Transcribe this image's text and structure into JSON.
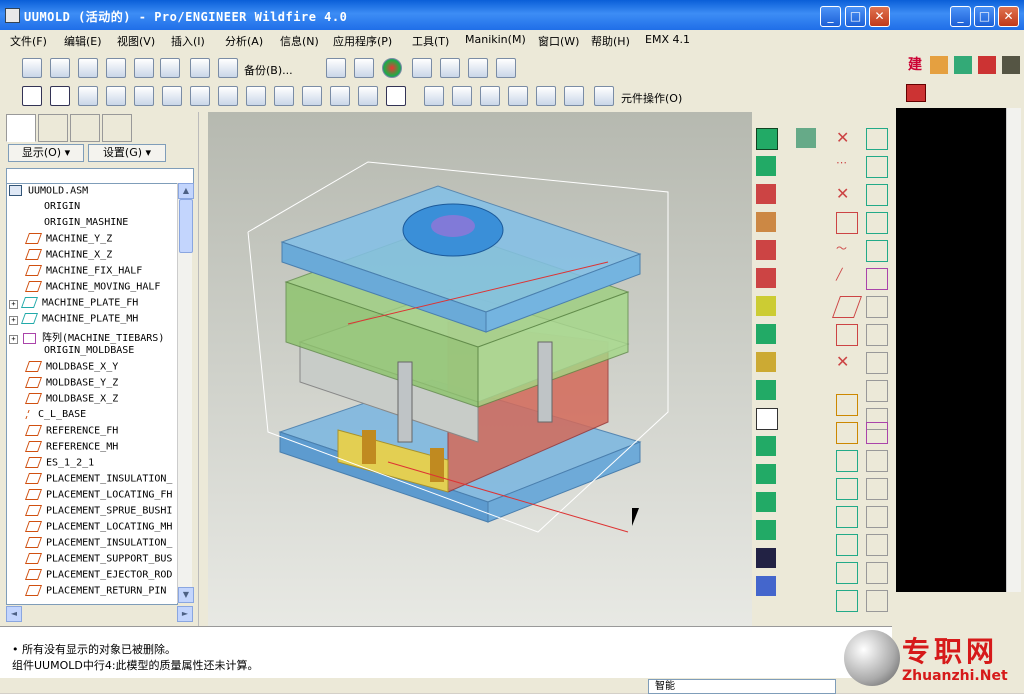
{
  "window": {
    "title": "UUMOLD (活动的) - Pro/ENGINEER Wildfire 4.0",
    "min": "_",
    "max": "□",
    "close": "✕"
  },
  "menu": [
    "文件(F)",
    "编辑(E)",
    "视图(V)",
    "插入(I)",
    "分析(A)",
    "信息(N)",
    "应用程序(P)",
    "工具(T)",
    "Manikin(M)",
    "窗口(W)",
    "帮助(H)",
    "EMX 4.1"
  ],
  "toolbar": {
    "backup_label": "备份(B)...",
    "component_ops_label": "元件操作(O)"
  },
  "leftpanel": {
    "show_label": "显示(O) ▾",
    "settings_label": "设置(G) ▾"
  },
  "tree": {
    "items": [
      "UUMOLD.ASM",
      "ORIGIN",
      "ORIGIN_MASHINE",
      "MACHINE_Y_Z",
      "MACHINE_X_Z",
      "MACHINE_FIX_HALF",
      "MACHINE_MOVING_HALF",
      "MACHINE_PLATE_FH",
      "MACHINE_PLATE_MH",
      "阵列(MACHINE_TIEBARS)",
      "ORIGIN_MOLDBASE",
      "MOLDBASE_X_Y",
      "MOLDBASE_Y_Z",
      "MOLDBASE_X_Z",
      "C_L_BASE",
      "REFERENCE_FH",
      "REFERENCE_MH",
      "ES_1_2_1",
      "PLACEMENT_INSULATION_",
      "PLACEMENT_LOCATING_FH",
      "PLACEMENT_SPRUE_BUSHI",
      "PLACEMENT_LOCATING_MH",
      "PLACEMENT_INSULATION_",
      "PLACEMENT_SUPPORT_BUS",
      "PLACEMENT_EJECTOR_ROD",
      "PLACEMENT_RETURN_PIN"
    ]
  },
  "messages": [
    "• 所有没有显示的对象已被删除。",
    "组件UUMOLD中行4:此模型的质量属性还未计算。"
  ],
  "status": {
    "filter": "智能"
  },
  "background_window": {
    "toolbar_text": "建"
  },
  "watermark": {
    "cn": "专职网",
    "en": "Zhuanzhi.Net"
  },
  "colors": {
    "titlebar": "#0a5fd8",
    "mold_blue": "#7fb8e0",
    "mold_green": "#9ad07a",
    "mold_red": "#d46a5a"
  }
}
